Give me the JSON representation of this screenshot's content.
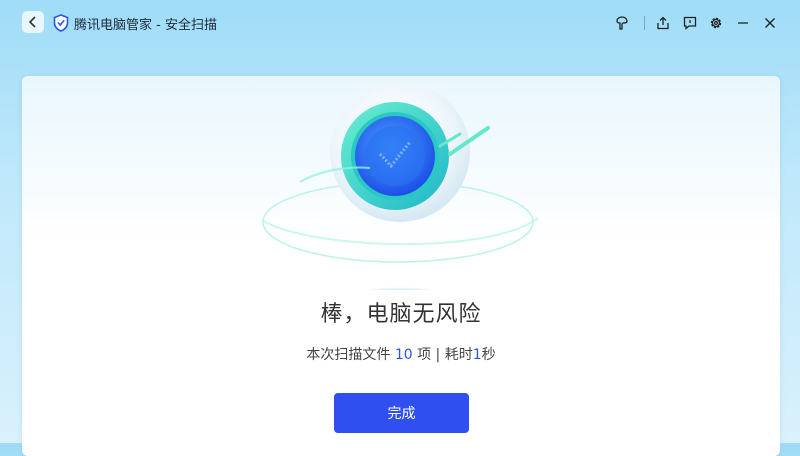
{
  "window": {
    "app_name": "腾讯电脑管家",
    "separator": " - ",
    "page_name": "安全扫描"
  },
  "toolbar": {
    "icons": [
      "skin-icon",
      "share-icon",
      "feedback-icon",
      "settings-icon",
      "minimize-icon",
      "close-icon"
    ]
  },
  "result": {
    "headline": "棒，电脑无风险",
    "summary_prefix": "本次扫描文件 ",
    "file_count": "10",
    "summary_mid": " 项 | 耗时",
    "duration": "1",
    "summary_suffix": "秒"
  },
  "actions": {
    "done_label": "完成"
  },
  "colors": {
    "primary": "#2f4ff0",
    "accent_number": "#2a55e8",
    "shield_teal": "#3ad9c4",
    "shield_blue": "#1e6cf0"
  }
}
